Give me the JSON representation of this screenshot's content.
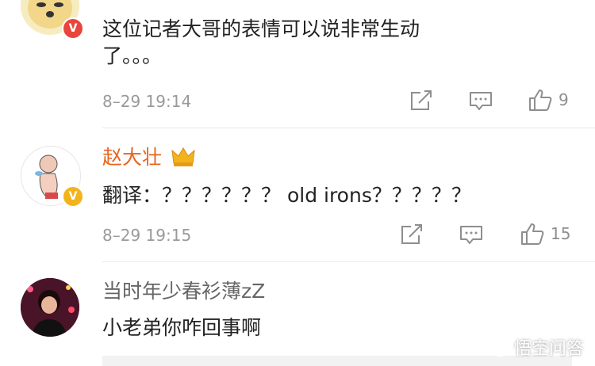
{
  "comments": [
    {
      "username": "",
      "text": "这位记者大哥的表情可以说非常生动\n了。。。",
      "time": "8–29 19:14",
      "likes": "9",
      "verified": "red-v"
    },
    {
      "username": "赵大壮",
      "text": "翻译：？？？？？？ old irons？？？？？",
      "time": "8–29 19:15",
      "likes": "15",
      "verified": "yellow-v",
      "username_color": "#e8641c"
    },
    {
      "username": "当时年少春衫薄zZ",
      "text": "小老弟你咋回事啊",
      "username_color": "#666666"
    }
  ],
  "badge_letter": "V",
  "watermark": "悟空问答",
  "colors": {
    "vip_red": "#e8641c",
    "gold": "#f3b31c",
    "red_v": "#e8463c"
  },
  "icons": [
    "share-icon",
    "comment-icon",
    "like-icon",
    "crown-icon",
    "wukong-logo-icon"
  ]
}
